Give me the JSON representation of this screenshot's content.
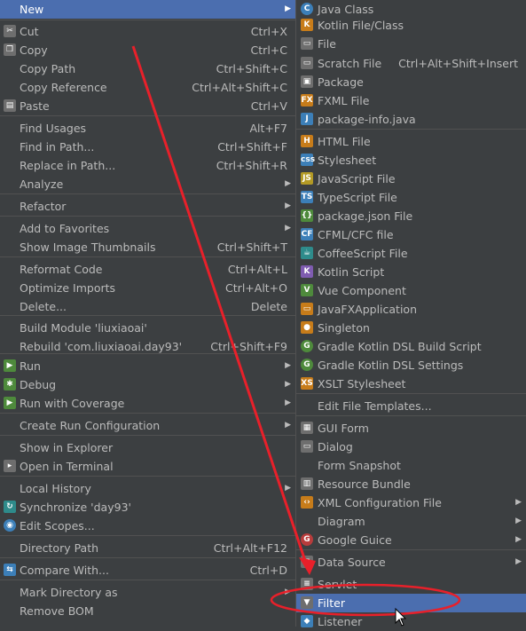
{
  "left_menu": {
    "items": [
      {
        "label": "New",
        "shortcut": "",
        "submenu": true,
        "icon": "",
        "selected": true
      },
      {
        "label": "Cut",
        "shortcut": "Ctrl+X",
        "submenu": false,
        "icon": "scissors-icon"
      },
      {
        "label": "Copy",
        "shortcut": "Ctrl+C",
        "submenu": false,
        "icon": "copy-icon"
      },
      {
        "label": "Copy Path",
        "shortcut": "Ctrl+Shift+C",
        "submenu": false,
        "icon": ""
      },
      {
        "label": "Copy Reference",
        "shortcut": "Ctrl+Alt+Shift+C",
        "submenu": false,
        "icon": ""
      },
      {
        "label": "Paste",
        "shortcut": "Ctrl+V",
        "submenu": false,
        "icon": "clipboard-icon"
      },
      {
        "label": "Find Usages",
        "shortcut": "Alt+F7",
        "submenu": false,
        "icon": ""
      },
      {
        "label": "Find in Path...",
        "shortcut": "Ctrl+Shift+F",
        "submenu": false,
        "icon": ""
      },
      {
        "label": "Replace in Path...",
        "shortcut": "Ctrl+Shift+R",
        "submenu": false,
        "icon": ""
      },
      {
        "label": "Analyze",
        "shortcut": "",
        "submenu": true,
        "icon": ""
      },
      {
        "label": "Refactor",
        "shortcut": "",
        "submenu": true,
        "icon": ""
      },
      {
        "label": "Add to Favorites",
        "shortcut": "",
        "submenu": true,
        "icon": ""
      },
      {
        "label": "Show Image Thumbnails",
        "shortcut": "Ctrl+Shift+T",
        "submenu": false,
        "icon": ""
      },
      {
        "label": "Reformat Code",
        "shortcut": "Ctrl+Alt+L",
        "submenu": false,
        "icon": ""
      },
      {
        "label": "Optimize Imports",
        "shortcut": "Ctrl+Alt+O",
        "submenu": false,
        "icon": ""
      },
      {
        "label": "Delete...",
        "shortcut": "Delete",
        "submenu": false,
        "icon": ""
      },
      {
        "label": "Build Module 'liuxiaoai'",
        "shortcut": "",
        "submenu": false,
        "icon": ""
      },
      {
        "label": "Rebuild 'com.liuxiaoai.day93'",
        "shortcut": "Ctrl+Shift+F9",
        "submenu": false,
        "icon": ""
      },
      {
        "label": "Run",
        "shortcut": "",
        "submenu": true,
        "icon": "run-icon"
      },
      {
        "label": "Debug",
        "shortcut": "",
        "submenu": true,
        "icon": "debug-icon"
      },
      {
        "label": "Run with Coverage",
        "shortcut": "",
        "submenu": true,
        "icon": "coverage-icon"
      },
      {
        "label": "Create Run Configuration",
        "shortcut": "",
        "submenu": true,
        "icon": ""
      },
      {
        "label": "Show in Explorer",
        "shortcut": "",
        "submenu": false,
        "icon": ""
      },
      {
        "label": "Open in Terminal",
        "shortcut": "",
        "submenu": false,
        "icon": "terminal-icon"
      },
      {
        "label": "Local History",
        "shortcut": "",
        "submenu": true,
        "icon": ""
      },
      {
        "label": "Synchronize 'day93'",
        "shortcut": "",
        "submenu": false,
        "icon": "sync-icon"
      },
      {
        "label": "Edit Scopes...",
        "shortcut": "",
        "submenu": false,
        "icon": "scopes-icon"
      },
      {
        "label": "Directory Path",
        "shortcut": "Ctrl+Alt+F12",
        "submenu": false,
        "icon": ""
      },
      {
        "label": "Compare With...",
        "shortcut": "Ctrl+D",
        "submenu": false,
        "icon": "compare-icon"
      },
      {
        "label": "Mark Directory as",
        "shortcut": "",
        "submenu": true,
        "icon": ""
      },
      {
        "label": "Remove BOM",
        "shortcut": "",
        "submenu": false,
        "icon": ""
      }
    ]
  },
  "right_menu": {
    "items": [
      {
        "label": "Java Class",
        "shortcut": "",
        "submenu": false,
        "icon": "java-class-icon",
        "glyph": "C"
      },
      {
        "label": "Kotlin File/Class",
        "shortcut": "",
        "submenu": false,
        "icon": "kotlin-icon",
        "glyph": "K"
      },
      {
        "label": "File",
        "shortcut": "",
        "submenu": false,
        "icon": "file-icon",
        "glyph": ""
      },
      {
        "label": "Scratch File",
        "shortcut": "Ctrl+Alt+Shift+Insert",
        "submenu": false,
        "icon": "scratch-file-icon",
        "glyph": ""
      },
      {
        "label": "Package",
        "shortcut": "",
        "submenu": false,
        "icon": "package-icon",
        "glyph": ""
      },
      {
        "label": "FXML File",
        "shortcut": "",
        "submenu": false,
        "icon": "fxml-icon",
        "glyph": "FX"
      },
      {
        "label": "package-info.java",
        "shortcut": "",
        "submenu": false,
        "icon": "package-info-icon",
        "glyph": "J"
      },
      {
        "label": "HTML File",
        "shortcut": "",
        "submenu": false,
        "icon": "html-icon",
        "glyph": "H"
      },
      {
        "label": "Stylesheet",
        "shortcut": "",
        "submenu": false,
        "icon": "css-icon",
        "glyph": "css"
      },
      {
        "label": "JavaScript File",
        "shortcut": "",
        "submenu": false,
        "icon": "javascript-icon",
        "glyph": "JS"
      },
      {
        "label": "TypeScript File",
        "shortcut": "",
        "submenu": false,
        "icon": "typescript-icon",
        "glyph": "TS"
      },
      {
        "label": "package.json File",
        "shortcut": "",
        "submenu": false,
        "icon": "package-json-icon",
        "glyph": "{}"
      },
      {
        "label": "CFML/CFC file",
        "shortcut": "",
        "submenu": false,
        "icon": "cfml-icon",
        "glyph": "CF"
      },
      {
        "label": "CoffeeScript File",
        "shortcut": "",
        "submenu": false,
        "icon": "coffeescript-icon",
        "glyph": ""
      },
      {
        "label": "Kotlin Script",
        "shortcut": "",
        "submenu": false,
        "icon": "kotlin-script-icon",
        "glyph": "K"
      },
      {
        "label": "Vue Component",
        "shortcut": "",
        "submenu": false,
        "icon": "vue-icon",
        "glyph": "V"
      },
      {
        "label": "JavaFXApplication",
        "shortcut": "",
        "submenu": false,
        "icon": "javafx-icon",
        "glyph": ""
      },
      {
        "label": "Singleton",
        "shortcut": "",
        "submenu": false,
        "icon": "singleton-icon",
        "glyph": ""
      },
      {
        "label": "Gradle Kotlin DSL Build Script",
        "shortcut": "",
        "submenu": false,
        "icon": "gradle-icon",
        "glyph": "G"
      },
      {
        "label": "Gradle Kotlin DSL Settings",
        "shortcut": "",
        "submenu": false,
        "icon": "gradle-settings-icon",
        "glyph": "G"
      },
      {
        "label": "XSLT Stylesheet",
        "shortcut": "",
        "submenu": false,
        "icon": "xslt-icon",
        "glyph": "XS"
      },
      {
        "label": "Edit File Templates...",
        "shortcut": "",
        "submenu": false,
        "icon": "",
        "glyph": ""
      },
      {
        "label": "GUI Form",
        "shortcut": "",
        "submenu": false,
        "icon": "gui-form-icon",
        "glyph": ""
      },
      {
        "label": "Dialog",
        "shortcut": "",
        "submenu": false,
        "icon": "dialog-icon",
        "glyph": ""
      },
      {
        "label": "Form Snapshot",
        "shortcut": "",
        "submenu": false,
        "icon": "",
        "glyph": ""
      },
      {
        "label": "Resource Bundle",
        "shortcut": "",
        "submenu": false,
        "icon": "resource-bundle-icon",
        "glyph": ""
      },
      {
        "label": "XML Configuration File",
        "shortcut": "",
        "submenu": true,
        "icon": "xml-config-icon",
        "glyph": ""
      },
      {
        "label": "Diagram",
        "shortcut": "",
        "submenu": true,
        "icon": "",
        "glyph": ""
      },
      {
        "label": "Google Guice",
        "shortcut": "",
        "submenu": true,
        "icon": "google-icon",
        "glyph": "G"
      },
      {
        "label": "Data Source",
        "shortcut": "",
        "submenu": true,
        "icon": "data-source-icon",
        "glyph": ""
      },
      {
        "label": "Servlet",
        "shortcut": "",
        "submenu": false,
        "icon": "servlet-icon",
        "glyph": ""
      },
      {
        "label": "Filter",
        "shortcut": "",
        "submenu": false,
        "icon": "filter-icon",
        "glyph": "",
        "selected": true
      },
      {
        "label": "Listener",
        "shortcut": "",
        "submenu": false,
        "icon": "listener-icon",
        "glyph": ""
      }
    ]
  },
  "colors": {
    "menu_bg": "#3c3f41",
    "selection": "#4b6eaf",
    "annotation_red": "#e8202a"
  }
}
